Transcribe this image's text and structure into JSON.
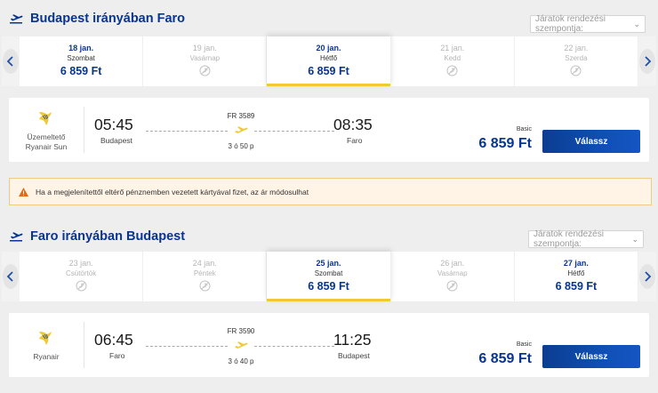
{
  "outbound": {
    "title": "Budapest irányában Faro",
    "sort_label": "Járatok rendezési szempontja:",
    "dates": [
      {
        "date": "18 jan.",
        "day": "Szombat",
        "price": "6 859 Ft",
        "available": true,
        "selected": false
      },
      {
        "date": "19 jan.",
        "day": "Vasárnap",
        "price": "",
        "available": false,
        "selected": false
      },
      {
        "date": "20 jan.",
        "day": "Hétfő",
        "price": "6 859 Ft",
        "available": true,
        "selected": true
      },
      {
        "date": "21 jan.",
        "day": "Kedd",
        "price": "",
        "available": false,
        "selected": false
      },
      {
        "date": "22 jan.",
        "day": "Szerda",
        "price": "",
        "available": false,
        "selected": false
      }
    ],
    "flight": {
      "operator_label": "Üzemeltető",
      "operator_name": "Ryanair Sun",
      "depart_time": "05:45",
      "depart_city": "Budapest",
      "flight_number": "FR 3589",
      "duration": "3 ó 50 p",
      "arrive_time": "08:35",
      "arrive_city": "Faro",
      "fare_type": "Basic",
      "price": "6 859 Ft",
      "select_label": "Válassz"
    }
  },
  "warning_text": "Ha a megjelenítettől eltérő pénznemben vezetett kártyával fizet, az ár módosulhat",
  "inbound": {
    "title": "Faro irányában Budapest",
    "sort_label": "Járatok rendezési szempontja:",
    "dates": [
      {
        "date": "23 jan.",
        "day": "Csütörtök",
        "price": "",
        "available": false,
        "selected": false
      },
      {
        "date": "24 jan.",
        "day": "Péntek",
        "price": "",
        "available": false,
        "selected": false
      },
      {
        "date": "25 jan.",
        "day": "Szombat",
        "price": "6 859 Ft",
        "available": true,
        "selected": true
      },
      {
        "date": "26 jan.",
        "day": "Vasárnap",
        "price": "",
        "available": false,
        "selected": false
      },
      {
        "date": "27 jan.",
        "day": "Hétfő",
        "price": "6 859 Ft",
        "available": true,
        "selected": false
      }
    ],
    "flight": {
      "operator_label": "",
      "operator_name": "Ryanair",
      "depart_time": "06:45",
      "depart_city": "Faro",
      "flight_number": "FR 3590",
      "duration": "3 ó 40 p",
      "arrive_time": "11:25",
      "arrive_city": "Budapest",
      "fare_type": "Basic",
      "price": "6 859 Ft",
      "select_label": "Válassz"
    }
  },
  "colors": {
    "brand_blue": "#073590",
    "accent_yellow": "#f1c933",
    "button_blue": "#0f4fb4",
    "warning_bg": "#fff4e6",
    "warning_icon": "#e0691b"
  }
}
